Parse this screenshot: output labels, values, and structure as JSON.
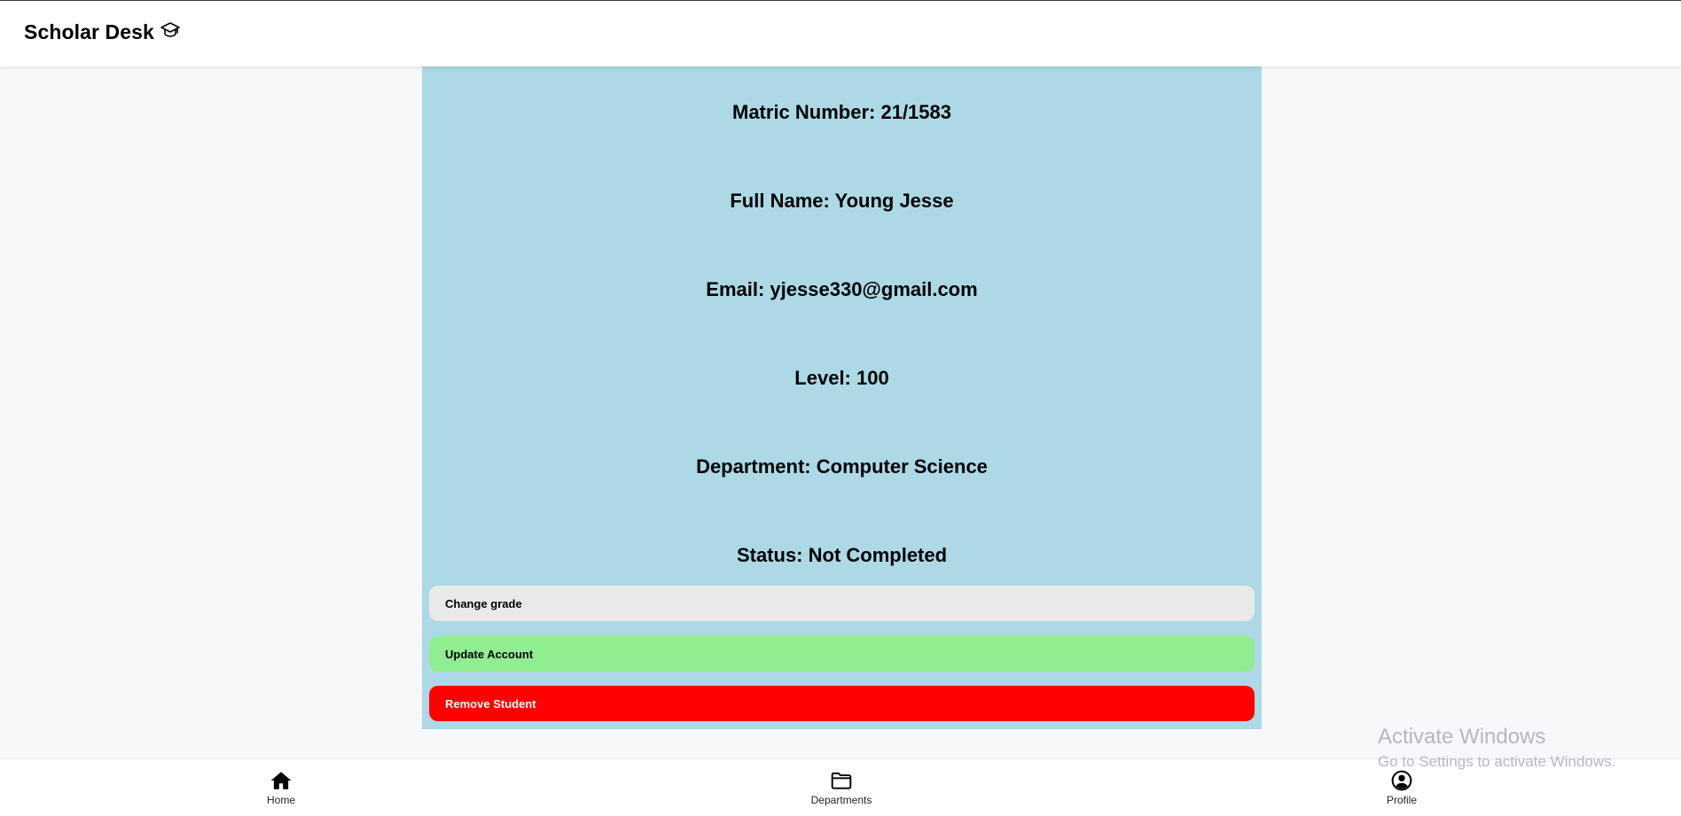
{
  "header": {
    "app_name": "Scholar Desk",
    "logo_icon": "graduation-cap-icon"
  },
  "student": {
    "matric": "Matric Number: 21/1583",
    "full_name": "Full Name: Young Jesse",
    "email": "Email: yjesse330@gmail.com",
    "level": "Level: 100",
    "department": "Department: Computer Science",
    "status": "Status: Not Completed"
  },
  "actions": {
    "change_grade": "Change grade",
    "update_account": "Update Account",
    "remove_student": "Remove Student"
  },
  "nav": {
    "home": {
      "label": "Home",
      "icon": "home-icon"
    },
    "departments": {
      "label": "Departments",
      "icon": "folder-icon"
    },
    "profile": {
      "label": "Profile",
      "icon": "user-circle-icon"
    }
  },
  "watermark": {
    "title": "Activate Windows",
    "subtitle": "Go to Settings to activate Windows."
  },
  "colors": {
    "card_bg": "#add8e6",
    "change_grade_bg": "#e9e9e9",
    "update_bg": "#90ee90",
    "remove_bg": "#ff0000",
    "page_bg": "#f7f8fa"
  }
}
